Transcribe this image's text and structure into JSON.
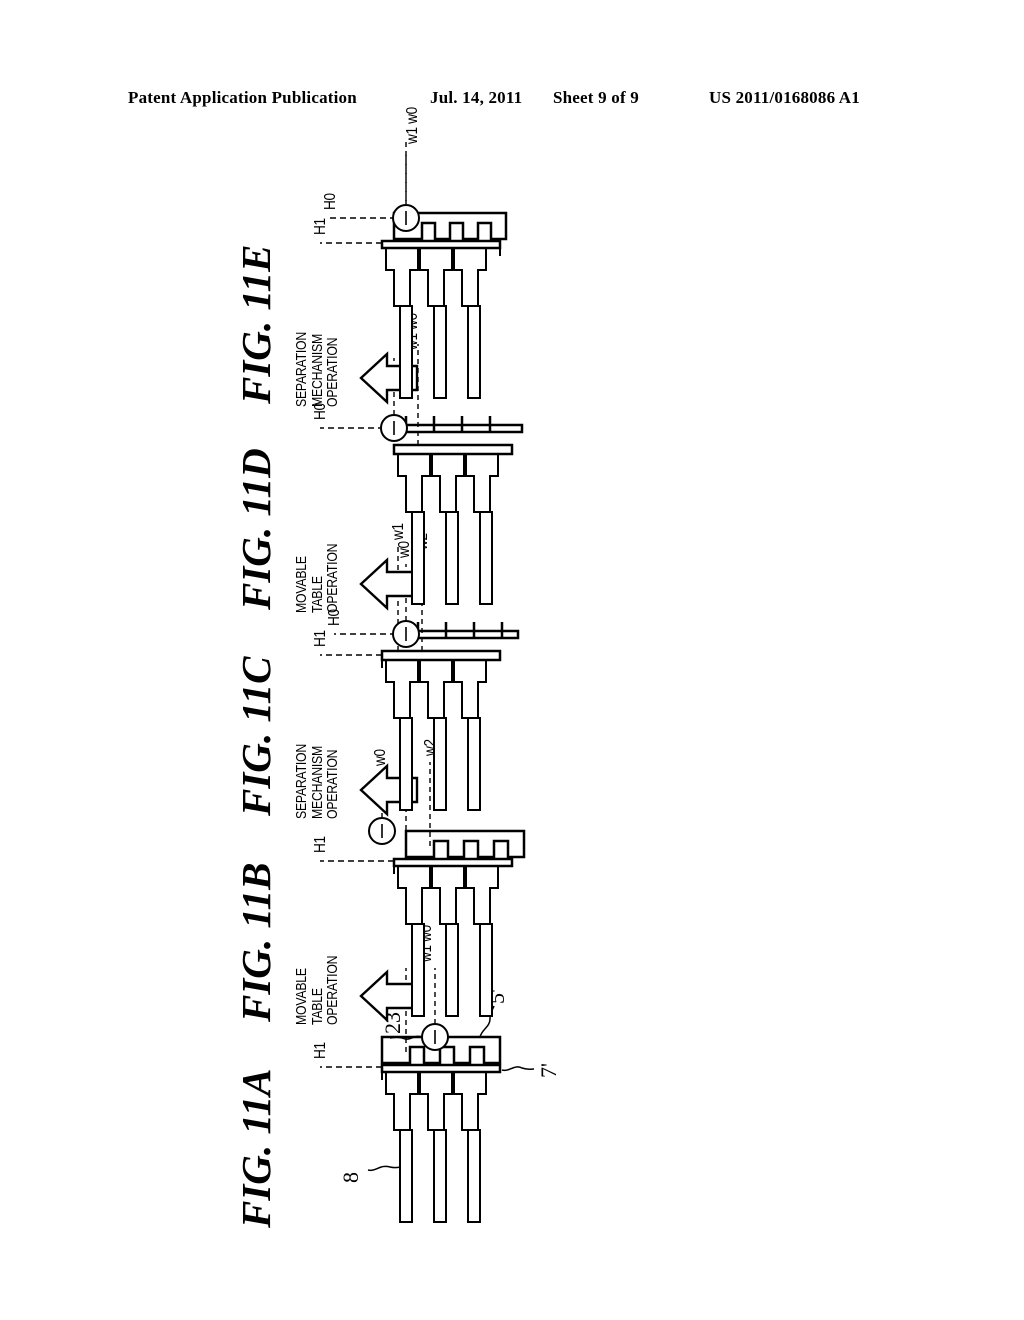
{
  "header": {
    "publication": "Patent Application Publication",
    "date": "Jul. 14, 2011",
    "sheet": "Sheet 9 of 9",
    "number": "US 2011/0168086 A1"
  },
  "figure_titles": [
    {
      "label": "FIG. 11A"
    },
    {
      "label": "FIG. 11B"
    },
    {
      "label": "FIG. 11C"
    },
    {
      "label": "FIG. 11D"
    },
    {
      "label": "FIG. 11E"
    }
  ],
  "transitions": [
    {
      "line1": "MOVABLE",
      "line2": "TABLE",
      "line3": "OPERATION"
    },
    {
      "line1": "SEPARATION",
      "line2": "MECHANISM",
      "line3": "OPERATION"
    },
    {
      "line1": "MOVABLE",
      "line2": "TABLE",
      "line3": "OPERATION"
    },
    {
      "line1": "SEPARATION",
      "line2": "MECHANISM",
      "line3": "OPERATION"
    }
  ],
  "arrow_icon": "up-arrow-icon",
  "panels": [
    {
      "id": "fig-11a",
      "height_labels": [
        "H1"
      ],
      "width_labels": [
        "w1",
        "w0"
      ],
      "reference_numerals": [
        "8",
        "7'",
        "5'",
        "23"
      ],
      "table_engaged": true
    },
    {
      "id": "fig-11b",
      "height_labels": [
        "H1"
      ],
      "width_labels": [
        "w2",
        "w1",
        "w0"
      ],
      "reference_numerals": [],
      "table_engaged": true
    },
    {
      "id": "fig-11c",
      "height_labels": [
        "H1",
        "H0"
      ],
      "width_labels": [
        "w2",
        "w1",
        "w0"
      ],
      "reference_numerals": [],
      "table_engaged": false
    },
    {
      "id": "fig-11d",
      "height_labels": [
        "H0"
      ],
      "width_labels": [
        "w1",
        "w0"
      ],
      "reference_numerals": [],
      "table_engaged": false
    },
    {
      "id": "fig-11e",
      "height_labels": [
        "H1",
        "H0"
      ],
      "width_labels": [
        "w1",
        "w0"
      ],
      "reference_numerals": [],
      "table_engaged": true
    }
  ],
  "labels": {
    "H1": "H1",
    "H0": "H0",
    "w0": "w0",
    "w1": "w1",
    "w2": "w2",
    "w1w0": "w1 w0",
    "n8": "8",
    "n7p": "7'",
    "n5p": "5'",
    "n23": "23"
  },
  "colors": {
    "ink": "#000000",
    "paper": "#ffffff"
  }
}
